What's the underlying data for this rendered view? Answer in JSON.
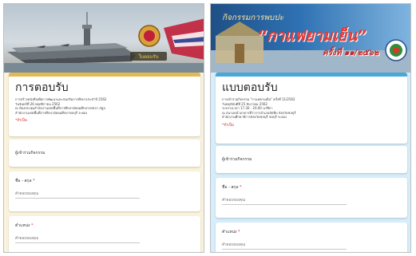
{
  "left_form": {
    "banner_badge": "ใบตอบรับ",
    "title": "การตอบรับ",
    "description_lines": [
      "การสร้างหนังสือเพื่อการพัฒนาและส่งเสริมการศึกษาประจำปี 2562",
      "วันจันทร์ที่ 26 พฤศจิกายน 2562",
      "ณ ห้องประชุมสำนักงานเขตพื้นที่การศึกษามัธยมศึกษาสงขลา สตูล",
      "สำนักงานเขตพื้นที่การศึกษามัธยมศึกษาชลบุรี ระยอง"
    ],
    "required_note": "*จำเป็น",
    "section_label": "ผู้เข้าร่วมกิจกรรม",
    "q1_label": "ชื่อ - สกุล",
    "q1_placeholder": "คำตอบของคุณ",
    "q2_label": "ตำแหน่ง",
    "q2_placeholder": "คำตอบของคุณ"
  },
  "right_form": {
    "banner_line1": "กิจกรรมการพบปะ",
    "banner_line2": "“กาแฟยามเย็น”",
    "banner_line3": "ครั้งที่ ๑๑/๒๕๖๒",
    "title": "แบบตอบรับ",
    "description_lines": [
      "การเข้าร่วมกิจกรรม \"กาแฟยามเย็น\" ครั้งที่ 11/2562",
      "วันพฤหัสบดีที่ 25 ธันวาคม 2562",
      "ระหว่างเวลา 17.30 - 20.00 นาฬิกา",
      "ณ สนามหน้าอาคารที่ว่าการอำเภอสัตหีบ จังหวัดชลบุรี",
      "สำนักงานศึกษาธิการจังหวัดชลบุรี ชลบุรี ระยอง"
    ],
    "required_note": "*จำเป็น",
    "section_label": "ผู้เข้าร่วมกิจกรรม",
    "q1_label": "ชื่อ - สกุล",
    "q1_placeholder": "คำตอบของคุณ",
    "q2_label": "ตำแหน่ง",
    "q2_placeholder": "คำตอบของคุณ"
  },
  "colors": {
    "left_accent": "#e3ba52",
    "right_accent": "#4aa7d8",
    "required": "#d32f2f"
  }
}
